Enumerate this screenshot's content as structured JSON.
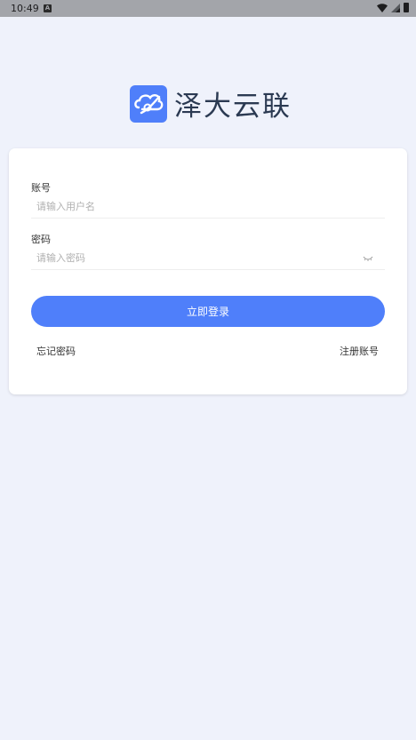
{
  "status_bar": {
    "time": "10:49",
    "notification_icon": "a-icon",
    "icons": [
      "wifi-icon",
      "signal-icon",
      "battery-icon"
    ]
  },
  "brand": {
    "logo_icon": "cloud-link-logo-icon",
    "name": "泽大云联",
    "accent_color": "#4f7ffa"
  },
  "login_form": {
    "account_label": "账号",
    "account_placeholder": "请输入用户名",
    "account_value": "",
    "password_label": "密码",
    "password_placeholder": "请输入密码",
    "password_value": "",
    "password_toggle_icon": "eye-closed-icon",
    "submit_label": "立即登录",
    "forgot_password_label": "忘记密码",
    "register_label": "注册账号"
  }
}
